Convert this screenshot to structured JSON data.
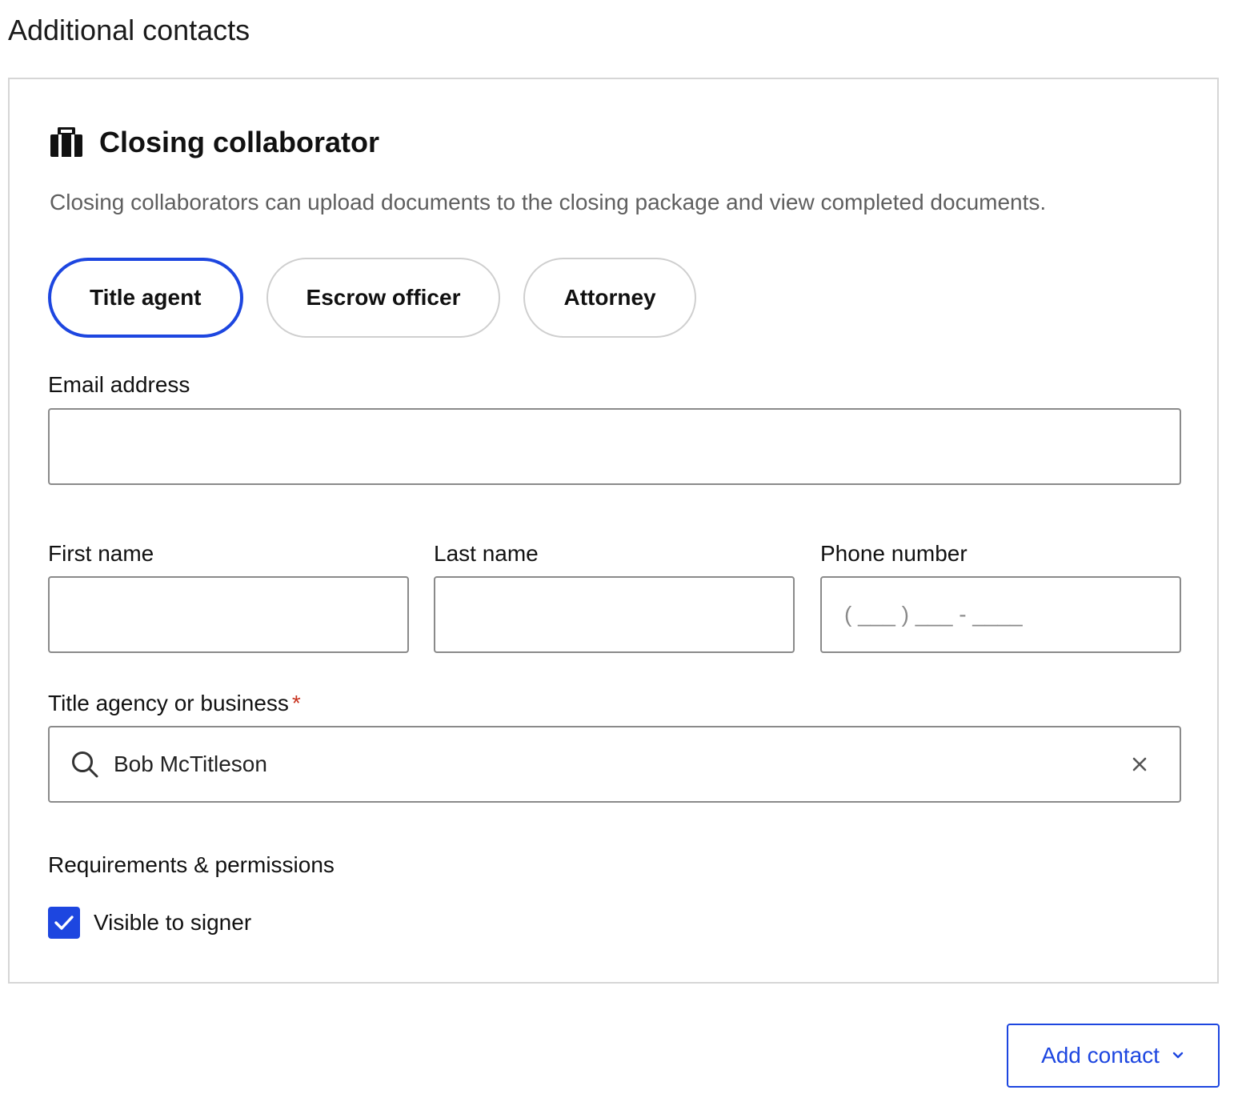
{
  "page": {
    "section_title": "Additional contacts"
  },
  "card": {
    "title": "Closing collaborator",
    "icon": "briefcase-icon",
    "description": "Closing collaborators can upload documents to the closing package and view completed documents."
  },
  "roles": {
    "selected": "Title agent",
    "items": [
      {
        "label": "Title agent"
      },
      {
        "label": "Escrow officer"
      },
      {
        "label": "Attorney"
      }
    ]
  },
  "fields": {
    "email": {
      "label": "Email address",
      "value": "",
      "placeholder": ""
    },
    "first_name": {
      "label": "First name",
      "value": "",
      "placeholder": ""
    },
    "last_name": {
      "label": "Last name",
      "value": "",
      "placeholder": ""
    },
    "phone": {
      "label": "Phone number",
      "value": "",
      "placeholder": "( ___ ) ___ - ____"
    },
    "agency": {
      "label": "Title agency or business",
      "required_mark": "*",
      "value": "Bob McTitleson",
      "placeholder": ""
    }
  },
  "permissions": {
    "heading": "Requirements & permissions",
    "visible_to_signer": {
      "label": "Visible to signer",
      "checked": true
    }
  },
  "actions": {
    "add_contact_label": "Add contact"
  },
  "colors": {
    "accent": "#1d46e0",
    "required": "#c8321e",
    "border": "#8a8a8a"
  }
}
